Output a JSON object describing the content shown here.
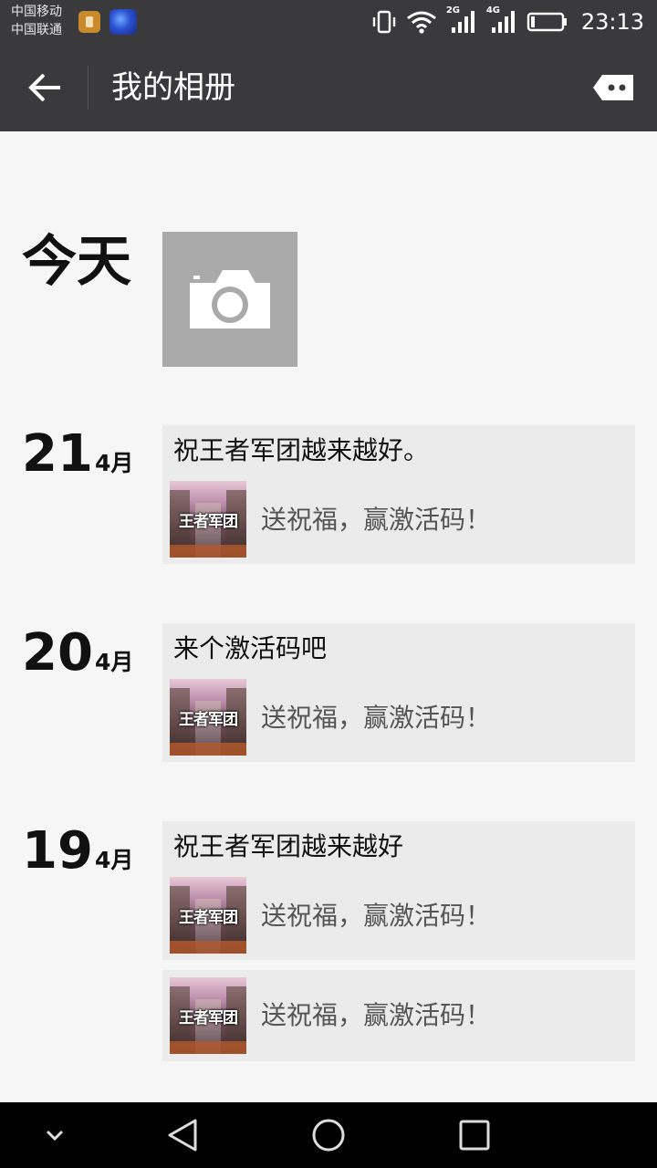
{
  "status_bar": {
    "carrier1": "中国移动",
    "carrier2": "中国联通",
    "net1": "2G",
    "net2": "4G",
    "time": "23:13"
  },
  "header": {
    "title": "我的相册"
  },
  "today": {
    "label": "今天"
  },
  "days": [
    {
      "day": "21",
      "month": "4月"
    },
    {
      "day": "20",
      "month": "4月"
    },
    {
      "day": "19",
      "month": "4月"
    }
  ],
  "posts": [
    {
      "text": "祝王者军团越来越好。",
      "thumb_label": "王者军团",
      "share_text": "送祝福，赢激活码！"
    },
    {
      "text": "来个激活码吧",
      "thumb_label": "王者军团",
      "share_text": "送祝福，赢激活码！"
    },
    {
      "text": "祝王者军团越来越好",
      "thumb_label": "王者军团",
      "share_text": "送祝福，赢激活码！"
    },
    {
      "text": "",
      "thumb_label": "王者军团",
      "share_text": "送祝福，赢激活码！"
    }
  ],
  "colors": {
    "header_bg": "#3a3a3c",
    "content_bg": "#f6f6f6",
    "card_bg": "#ebebeb",
    "camera_tile_bg": "#aaaaaa"
  }
}
